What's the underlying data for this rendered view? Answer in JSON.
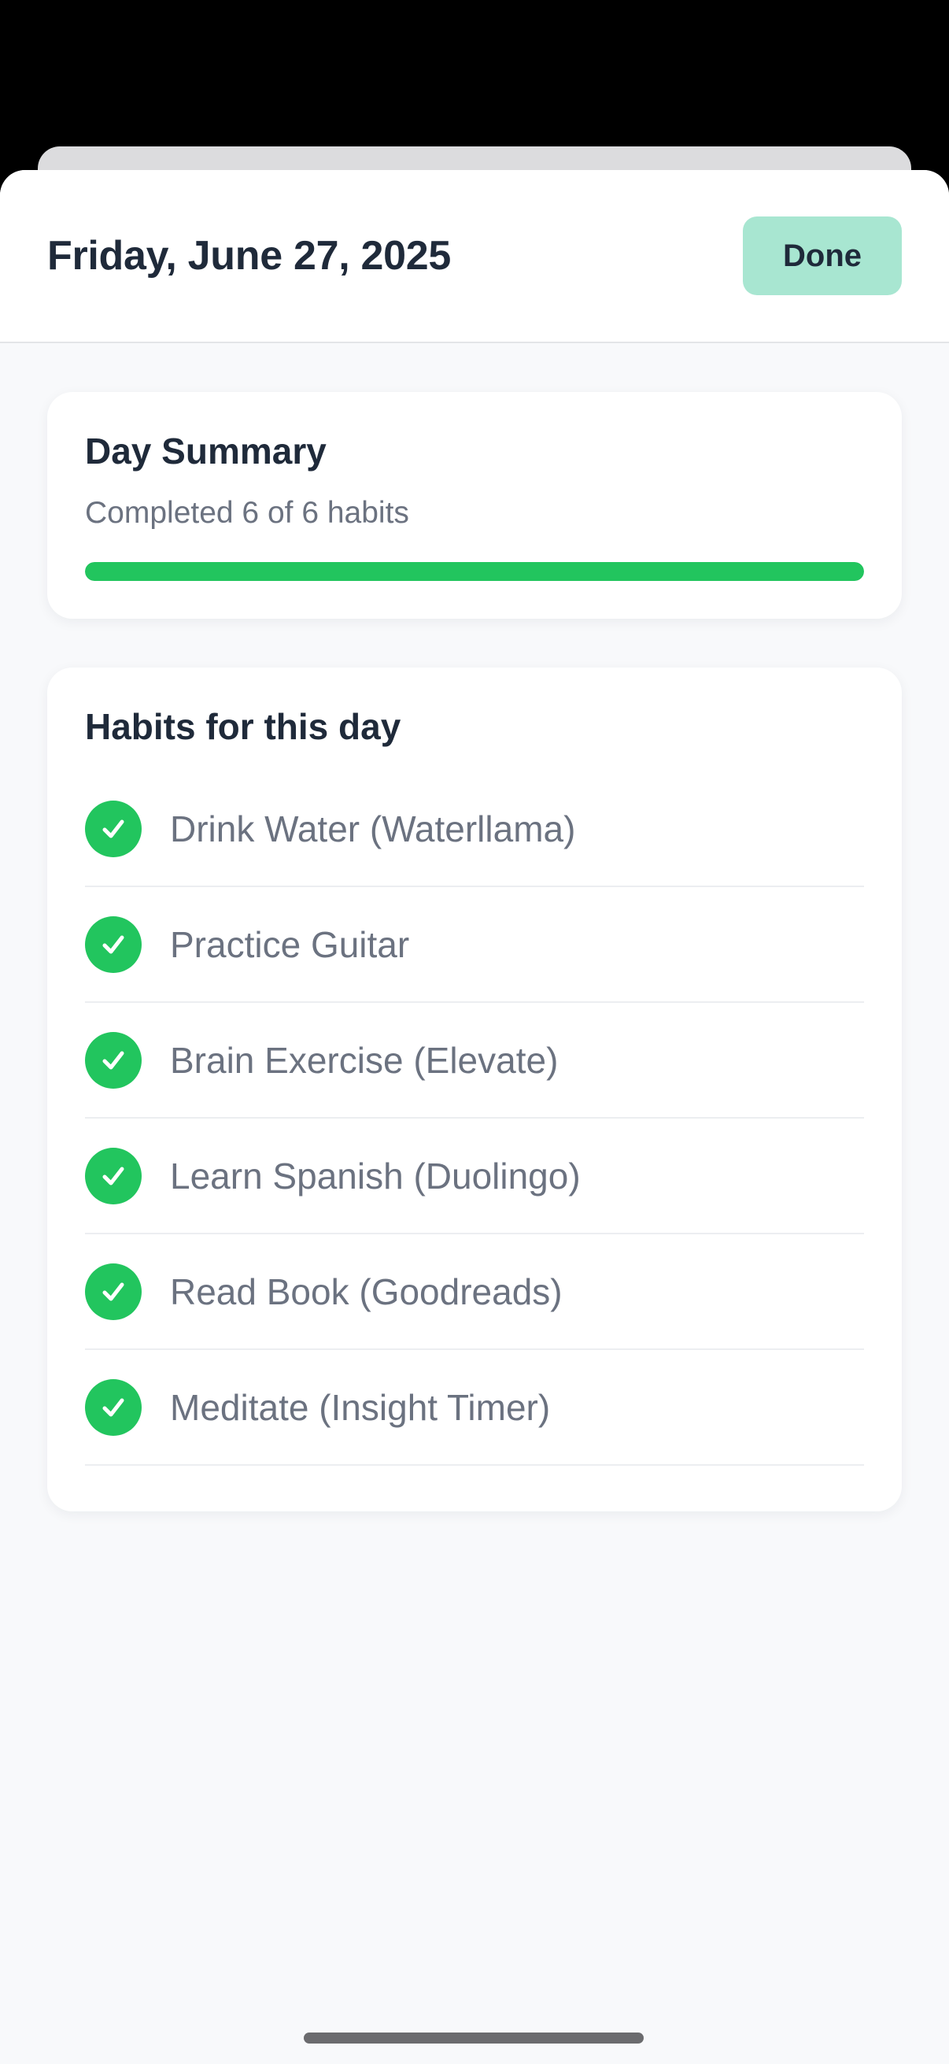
{
  "header": {
    "date_title": "Friday, June 27, 2025",
    "done_label": "Done"
  },
  "summary": {
    "title": "Day Summary",
    "subtitle": "Completed 6 of 6 habits",
    "progress_fraction": 1.0,
    "progress_color": "#22c55e"
  },
  "habits": {
    "title": "Habits for this day",
    "items": [
      {
        "label": "Drink Water (Waterllama)",
        "icon": "checkmark-circle-icon",
        "completed": true
      },
      {
        "label": "Practice Guitar",
        "icon": "checkmark-circle-icon",
        "completed": true
      },
      {
        "label": "Brain Exercise (Elevate)",
        "icon": "checkmark-circle-icon",
        "completed": true
      },
      {
        "label": "Learn Spanish (Duolingo)",
        "icon": "checkmark-circle-icon",
        "completed": true
      },
      {
        "label": "Read Book (Goodreads)",
        "icon": "checkmark-circle-icon",
        "completed": true
      },
      {
        "label": "Meditate (Insight Timer)",
        "icon": "checkmark-circle-icon",
        "completed": true
      }
    ]
  },
  "colors": {
    "accent": "#22c55e",
    "done_button": "#a8e6d1",
    "text_primary": "#1f2a3a",
    "text_secondary": "#6b7280"
  }
}
